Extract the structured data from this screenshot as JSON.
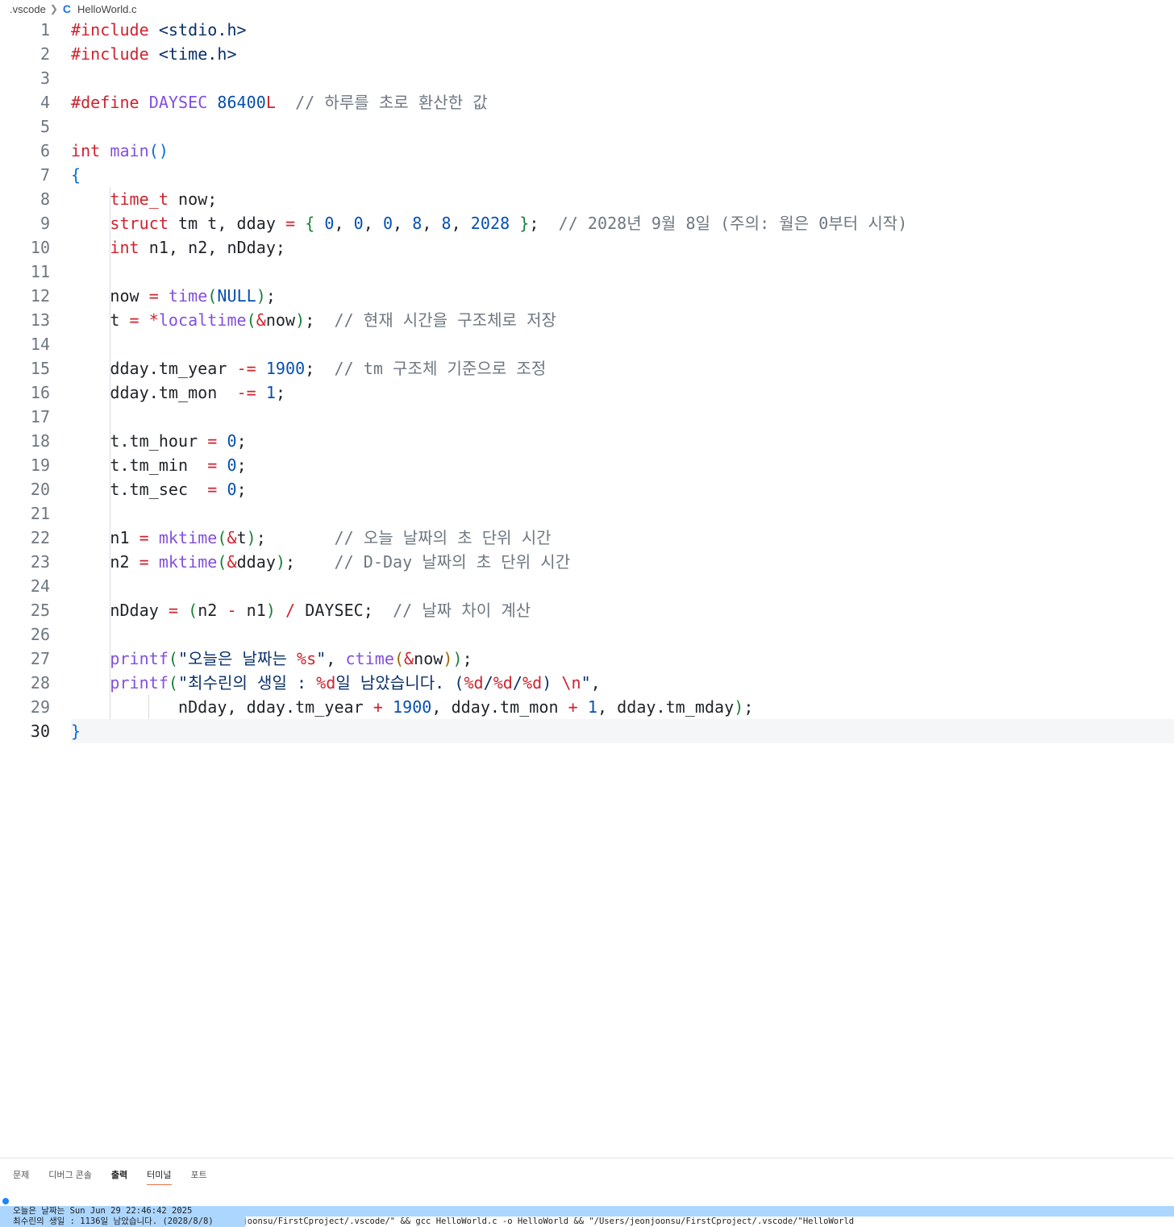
{
  "breadcrumb": {
    "folder": ".vscode",
    "file_icon": "C",
    "file": "HelloWorld.c"
  },
  "editor": {
    "active_line": 30,
    "lines": [
      [
        [
          "pp",
          "#include"
        ],
        [
          "tx",
          " "
        ],
        [
          "str",
          "<stdio.h>"
        ]
      ],
      [
        [
          "pp",
          "#include"
        ],
        [
          "tx",
          " "
        ],
        [
          "str",
          "<time.h>"
        ]
      ],
      [],
      [
        [
          "pp",
          "#define"
        ],
        [
          "tx",
          " "
        ],
        [
          "mac",
          "DAYSEC"
        ],
        [
          "tx",
          " "
        ],
        [
          "num",
          "86400"
        ],
        [
          "kw",
          "L"
        ],
        [
          "tx",
          "  "
        ],
        [
          "cm",
          "// 하루를 초로 환산한 값"
        ]
      ],
      [],
      [
        [
          "ty",
          "int"
        ],
        [
          "tx",
          " "
        ],
        [
          "fn",
          "main"
        ],
        [
          "b1",
          "()"
        ]
      ],
      [
        [
          "b1",
          "{"
        ]
      ],
      [
        [
          "tx",
          "    "
        ],
        [
          "ty",
          "time_t"
        ],
        [
          "tx",
          " now;"
        ]
      ],
      [
        [
          "tx",
          "    "
        ],
        [
          "kw",
          "struct"
        ],
        [
          "tx",
          " tm t, dday "
        ],
        [
          "op",
          "="
        ],
        [
          "tx",
          " "
        ],
        [
          "b2",
          "{"
        ],
        [
          "tx",
          " "
        ],
        [
          "num",
          "0"
        ],
        [
          "tx",
          ", "
        ],
        [
          "num",
          "0"
        ],
        [
          "tx",
          ", "
        ],
        [
          "num",
          "0"
        ],
        [
          "tx",
          ", "
        ],
        [
          "num",
          "8"
        ],
        [
          "tx",
          ", "
        ],
        [
          "num",
          "8"
        ],
        [
          "tx",
          ", "
        ],
        [
          "num",
          "2028"
        ],
        [
          "tx",
          " "
        ],
        [
          "b2",
          "}"
        ],
        [
          "tx",
          ";  "
        ],
        [
          "cm",
          "// 2028년 9월 8일 (주의: 월은 0부터 시작)"
        ]
      ],
      [
        [
          "tx",
          "    "
        ],
        [
          "ty",
          "int"
        ],
        [
          "tx",
          " n1, n2, nDday;"
        ]
      ],
      [],
      [
        [
          "tx",
          "    now "
        ],
        [
          "op",
          "="
        ],
        [
          "tx",
          " "
        ],
        [
          "fn",
          "time"
        ],
        [
          "b2",
          "("
        ],
        [
          "num",
          "NULL"
        ],
        [
          "b2",
          ")"
        ],
        [
          "tx",
          ";"
        ]
      ],
      [
        [
          "tx",
          "    t "
        ],
        [
          "op",
          "="
        ],
        [
          "tx",
          " "
        ],
        [
          "op",
          "*"
        ],
        [
          "fn",
          "localtime"
        ],
        [
          "b2",
          "("
        ],
        [
          "op",
          "&"
        ],
        [
          "tx",
          "now"
        ],
        [
          "b2",
          ")"
        ],
        [
          "tx",
          ";  "
        ],
        [
          "cm",
          "// 현재 시간을 구조체로 저장"
        ]
      ],
      [],
      [
        [
          "tx",
          "    dday.tm_year "
        ],
        [
          "op",
          "-="
        ],
        [
          "tx",
          " "
        ],
        [
          "num",
          "1900"
        ],
        [
          "tx",
          ";  "
        ],
        [
          "cm",
          "// tm 구조체 기준으로 조정"
        ]
      ],
      [
        [
          "tx",
          "    dday.tm_mon  "
        ],
        [
          "op",
          "-="
        ],
        [
          "tx",
          " "
        ],
        [
          "num",
          "1"
        ],
        [
          "tx",
          ";"
        ]
      ],
      [],
      [
        [
          "tx",
          "    t.tm_hour "
        ],
        [
          "op",
          "="
        ],
        [
          "tx",
          " "
        ],
        [
          "num",
          "0"
        ],
        [
          "tx",
          ";"
        ]
      ],
      [
        [
          "tx",
          "    t.tm_min  "
        ],
        [
          "op",
          "="
        ],
        [
          "tx",
          " "
        ],
        [
          "num",
          "0"
        ],
        [
          "tx",
          ";"
        ]
      ],
      [
        [
          "tx",
          "    t.tm_sec  "
        ],
        [
          "op",
          "="
        ],
        [
          "tx",
          " "
        ],
        [
          "num",
          "0"
        ],
        [
          "tx",
          ";"
        ]
      ],
      [],
      [
        [
          "tx",
          "    n1 "
        ],
        [
          "op",
          "="
        ],
        [
          "tx",
          " "
        ],
        [
          "fn",
          "mktime"
        ],
        [
          "b2",
          "("
        ],
        [
          "op",
          "&"
        ],
        [
          "tx",
          "t"
        ],
        [
          "b2",
          ")"
        ],
        [
          "tx",
          ";       "
        ],
        [
          "cm",
          "// 오늘 날짜의 초 단위 시간"
        ]
      ],
      [
        [
          "tx",
          "    n2 "
        ],
        [
          "op",
          "="
        ],
        [
          "tx",
          " "
        ],
        [
          "fn",
          "mktime"
        ],
        [
          "b2",
          "("
        ],
        [
          "op",
          "&"
        ],
        [
          "tx",
          "dday"
        ],
        [
          "b2",
          ")"
        ],
        [
          "tx",
          ";    "
        ],
        [
          "cm",
          "// D-Day 날짜의 초 단위 시간"
        ]
      ],
      [],
      [
        [
          "tx",
          "    nDday "
        ],
        [
          "op",
          "="
        ],
        [
          "tx",
          " "
        ],
        [
          "b2",
          "("
        ],
        [
          "tx",
          "n2 "
        ],
        [
          "op",
          "-"
        ],
        [
          "tx",
          " n1"
        ],
        [
          "b2",
          ")"
        ],
        [
          "tx",
          " "
        ],
        [
          "op",
          "/"
        ],
        [
          "tx",
          " DAYSEC;  "
        ],
        [
          "cm",
          "// 날짜 차이 계산"
        ]
      ],
      [],
      [
        [
          "tx",
          "    "
        ],
        [
          "fn",
          "printf"
        ],
        [
          "b2",
          "("
        ],
        [
          "str",
          "\"오늘은 날짜는 "
        ],
        [
          "esc",
          "%s"
        ],
        [
          "str",
          "\""
        ],
        [
          "tx",
          ", "
        ],
        [
          "fn",
          "ctime"
        ],
        [
          "b3",
          "("
        ],
        [
          "op",
          "&"
        ],
        [
          "tx",
          "now"
        ],
        [
          "b3",
          ")"
        ],
        [
          "b2",
          ")"
        ],
        [
          "tx",
          ";"
        ]
      ],
      [
        [
          "tx",
          "    "
        ],
        [
          "fn",
          "printf"
        ],
        [
          "b2",
          "("
        ],
        [
          "str",
          "\"최수린의 생일 : "
        ],
        [
          "esc",
          "%d"
        ],
        [
          "str",
          "일 남았습니다. ("
        ],
        [
          "esc",
          "%d"
        ],
        [
          "str",
          "/"
        ],
        [
          "esc",
          "%d"
        ],
        [
          "str",
          "/"
        ],
        [
          "esc",
          "%d"
        ],
        [
          "str",
          ") "
        ],
        [
          "esc",
          "\\n"
        ],
        [
          "str",
          "\""
        ],
        [
          "tx",
          ","
        ]
      ],
      [
        [
          "tx",
          "           nDday, dday.tm_year "
        ],
        [
          "op",
          "+"
        ],
        [
          "tx",
          " "
        ],
        [
          "num",
          "1900"
        ],
        [
          "tx",
          ", dday.tm_mon "
        ],
        [
          "op",
          "+"
        ],
        [
          "tx",
          " "
        ],
        [
          "num",
          "1"
        ],
        [
          "tx",
          ", dday.tm_mday"
        ],
        [
          "b2",
          ")"
        ],
        [
          "tx",
          ";"
        ]
      ],
      [
        [
          "b1",
          "}"
        ]
      ]
    ]
  },
  "panel": {
    "tabs": [
      "문제",
      "디버그 콘솔",
      "출력",
      "터미널",
      "포트"
    ],
    "active_tab": "터미널",
    "terminal": {
      "command": "FirstCproject/.vscode » cd \"/Users/jeonjoonsu/FirstCproject/.vscode/\" && gcc HelloWorld.c -o HelloWorld && \"/Users/jeonjoonsu/FirstCproject/.vscode/\"HelloWorld",
      "output1": "오늘은 날짜는 Sun Jun 29 22:46:42 2025",
      "output2": "최수린의 생일 : 1136일 남았습니다. (2028/8/8)"
    }
  }
}
